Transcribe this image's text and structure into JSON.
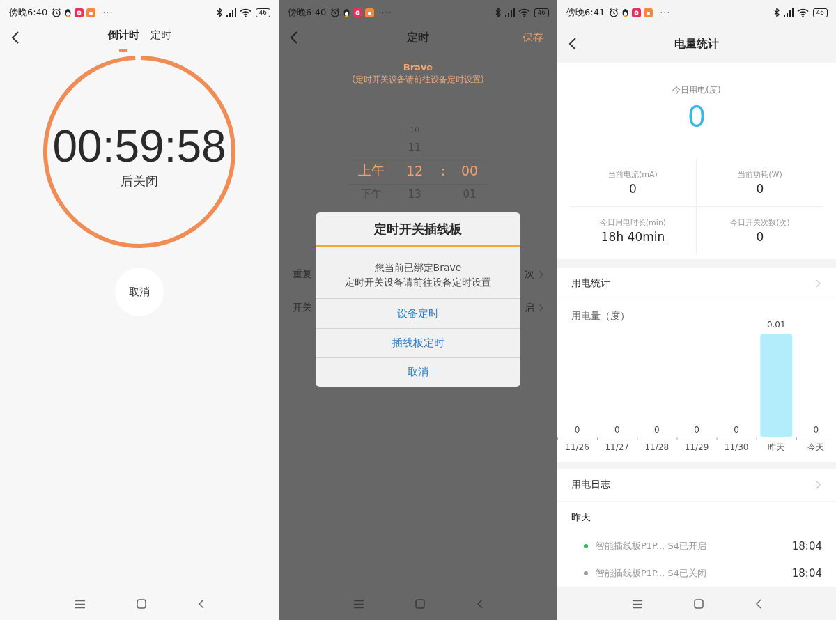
{
  "countdown_screen": {
    "status_bar": {
      "time": "傍晚6:40",
      "more": "···",
      "battery": "46"
    },
    "tabs": [
      {
        "label": "倒计时",
        "selected": true
      },
      {
        "label": "定时",
        "selected": false
      }
    ],
    "countdown": {
      "time": "00:59:58",
      "caption": "后关闭",
      "level": 0.99
    },
    "cancel_button": "取消"
  },
  "timer_screen": {
    "status_bar": {
      "time": "傍晚6:40",
      "more": "···",
      "battery": "46"
    },
    "title": "定时",
    "save": "保存",
    "device": "Brave",
    "hint": "(定时开关设备请前往设备定时设置)",
    "picker": [
      {
        "hour": "10",
        "selected": false
      },
      {
        "hour": "11",
        "selected": false
      },
      {
        "period": "上午",
        "hour": "12",
        "separator": ":",
        "minute": "00",
        "selected": true
      },
      {
        "period": "下午",
        "hour": "13",
        "minute": "01",
        "selected": false
      }
    ],
    "rows": [
      {
        "label": "重复",
        "value": "次"
      },
      {
        "label": "开关",
        "value": "启"
      }
    ],
    "dialog": {
      "title": "定时开关插线板",
      "message": "您当前已绑定Brave\n定时开关设备请前往设备定时设置",
      "buttons": [
        "设备定时",
        "插线板定时",
        "取消"
      ]
    }
  },
  "stats_screen": {
    "status_bar": {
      "time": "傍晚6:41",
      "more": "···",
      "battery": "46"
    },
    "title": "电量统计",
    "today": {
      "label": "今日用电(度)",
      "value": "0"
    },
    "metrics": [
      {
        "label": "当前电流(mA)",
        "value": "0"
      },
      {
        "label": "当前功耗(W)",
        "value": "0"
      },
      {
        "label": "今日用电时长(min)",
        "value": "18h 40min"
      },
      {
        "label": "今日开关次数(次)",
        "value": "0"
      }
    ],
    "usage_section": {
      "title": "用电统计",
      "chart_data": {
        "type": "bar",
        "title": "用电量（度）",
        "categories": [
          "11/26",
          "11/27",
          "11/28",
          "11/29",
          "11/30",
          "昨天",
          "今天"
        ],
        "values": [
          0,
          0,
          0,
          0,
          0,
          0.01,
          0
        ],
        "data_labels": true
      }
    },
    "log_section": {
      "title": "用电日志",
      "day": "昨天",
      "entries": [
        {
          "text": "智能插线板P1P... S4已开启",
          "time": "18:04",
          "color": "#3dbd5d"
        },
        {
          "text": "智能插线板P1P... S4已关闭",
          "time": "18:04",
          "color": "#9a9a9a"
        }
      ]
    }
  }
}
